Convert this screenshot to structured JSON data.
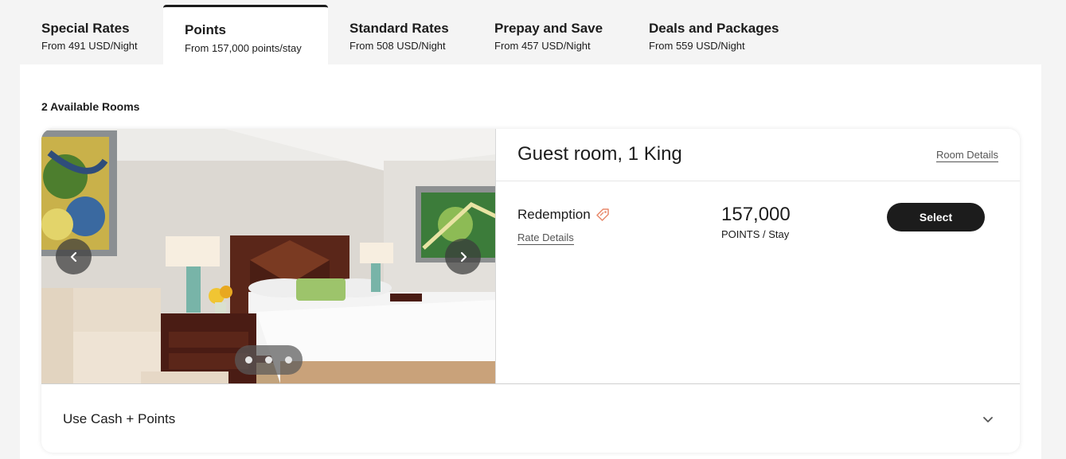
{
  "tabs": [
    {
      "title": "Special Rates",
      "sub": "From 491 USD/Night",
      "active": false
    },
    {
      "title": "Points",
      "sub": "From 157,000 points/stay",
      "active": true
    },
    {
      "title": "Standard Rates",
      "sub": "From 508 USD/Night",
      "active": false
    },
    {
      "title": "Prepay and Save",
      "sub": "From 457 USD/Night",
      "active": false
    },
    {
      "title": "Deals and Packages",
      "sub": "From 559 USD/Night",
      "active": false
    }
  ],
  "available_rooms": "2 Available Rooms",
  "room": {
    "title": "Guest room, 1 King",
    "details_link": "Room Details",
    "rate_name": "Redemption",
    "rate_details_link": "Rate Details",
    "points_value": "157,000",
    "points_unit": "POINTS / Stay",
    "select_label": "Select",
    "carousel_dots": 3
  },
  "cash_points_label": "Use Cash + Points",
  "icons": {
    "prev": "chevron-left-icon",
    "next": "chevron-right-icon",
    "rate_tag": "tag-icon",
    "expand": "chevron-down-icon"
  },
  "colors": {
    "accent_tag": "#e8896b",
    "button_bg": "#1c1c1c",
    "page_bg": "#f4f4f4"
  }
}
